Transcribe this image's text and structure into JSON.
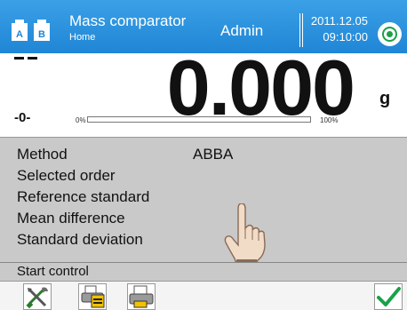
{
  "header": {
    "app_title": "Mass comparator",
    "app_subtitle": "Home",
    "user": "Admin",
    "date": "2011.12.05",
    "time": "09:10:00",
    "ab_icon_letters": [
      "A",
      "B"
    ],
    "accent_color": "#1f86d6"
  },
  "weighing": {
    "value": "0.000",
    "unit": "g",
    "zero_indicator": "-0-",
    "bar_min_label": "0%",
    "bar_max_label": "100%",
    "bar_fill_fraction": 0,
    "stability_icon": "stability-dash-icon"
  },
  "info": {
    "rows": [
      {
        "label": "Method",
        "value": "ABBA"
      },
      {
        "label": "Selected order",
        "value": ""
      },
      {
        "label": "Reference standard",
        "value": ""
      },
      {
        "label": "Mean difference",
        "value": ""
      },
      {
        "label": "Standard deviation",
        "value": ""
      }
    ]
  },
  "start_control": {
    "label": "Start control"
  },
  "toolbar": {
    "buttons": [
      {
        "icon": "tools-icon"
      },
      {
        "icon": "printer-report-icon"
      },
      {
        "icon": "printer-icon"
      },
      {
        "icon": "checkmark-icon"
      }
    ]
  }
}
